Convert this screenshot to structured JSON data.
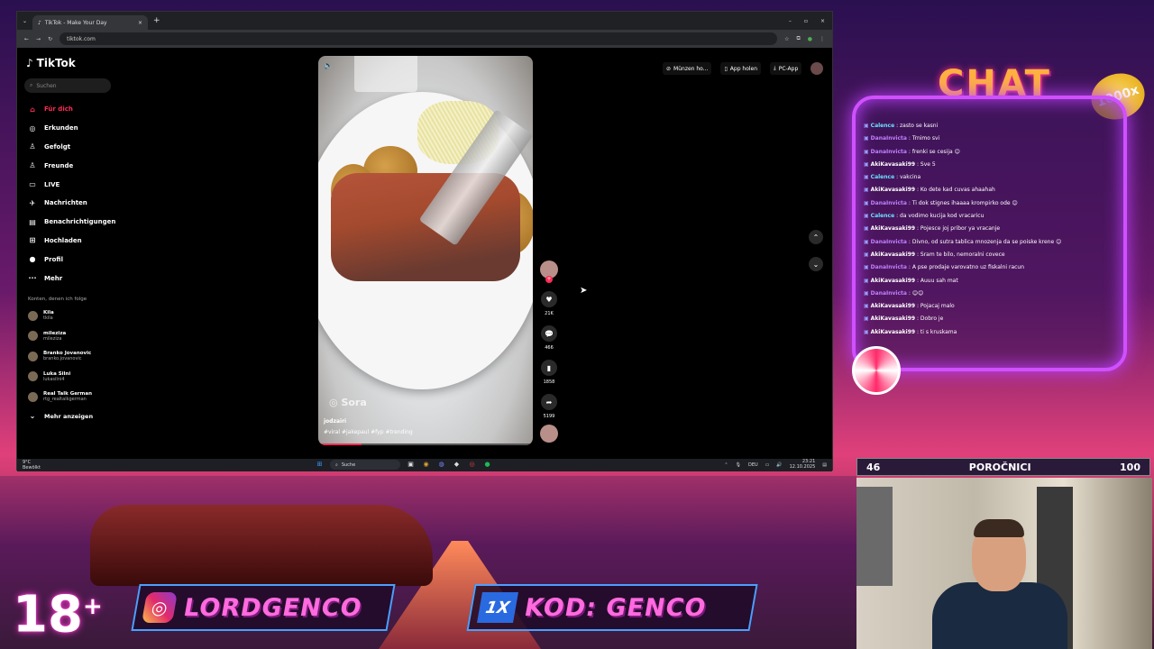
{
  "browser": {
    "tab_title": "TikTok - Make Your Day",
    "url": "tiktok.com"
  },
  "tiktok": {
    "logo": "TikTok",
    "search_placeholder": "Suchen",
    "nav": [
      {
        "label": "Für dich",
        "icon": "home-icon",
        "glyph": "⌂"
      },
      {
        "label": "Erkunden",
        "icon": "compass-icon",
        "glyph": "◎"
      },
      {
        "label": "Gefolgt",
        "icon": "person-follow-icon",
        "glyph": "♙"
      },
      {
        "label": "Freunde",
        "icon": "friends-icon",
        "glyph": "♙"
      },
      {
        "label": "LIVE",
        "icon": "live-icon",
        "glyph": "▭"
      },
      {
        "label": "Nachrichten",
        "icon": "message-icon",
        "glyph": "✈"
      },
      {
        "label": "Benachrichtigungen",
        "icon": "inbox-icon",
        "glyph": "▤"
      },
      {
        "label": "Hochladen",
        "icon": "upload-icon",
        "glyph": "⊞"
      },
      {
        "label": "Profil",
        "icon": "profile-icon",
        "glyph": "●"
      },
      {
        "label": "Mehr",
        "icon": "more-icon",
        "glyph": "···"
      }
    ],
    "following_heading": "Konten, denen ich folge",
    "following": [
      {
        "name": "Kila",
        "handle": "tkila"
      },
      {
        "name": "mileziza",
        "handle": "mileziza"
      },
      {
        "name": "Branko Jovanovic",
        "handle": "branko.jovanovic"
      },
      {
        "name": "Luka Silni",
        "handle": "lukasilni4"
      },
      {
        "name": "Real Talk German",
        "handle": "rtg_realtalkgerman"
      }
    ],
    "show_more": "Mehr anzeigen",
    "topbar": {
      "coins": "Münzen ho...",
      "app": "App holen",
      "pc_app": "PC-App"
    },
    "video": {
      "watermark": "Sora",
      "username": "jodzairi",
      "tags": "#viral #jakepaul #fyp #trending",
      "progress": 0.2
    },
    "actions": {
      "likes": "21K",
      "comments": "466",
      "saves": "1858",
      "shares": "5199"
    }
  },
  "taskbar": {
    "weather_temp": "9°C",
    "weather_desc": "Bewölkt",
    "search": "Suche",
    "lang": "DEU",
    "time": "23:21",
    "date": "12.10.2025"
  },
  "chat": {
    "title": "CHAT",
    "coin": "1000x",
    "messages": [
      {
        "user": "Calence",
        "text": ": zasto se kasni"
      },
      {
        "user": "DanaInvicta",
        "text": ": Trnimo svi"
      },
      {
        "user": "DanaInvicta",
        "text": ": frenki se cesija 😊"
      },
      {
        "user": "AkiKavasaki99",
        "text": ": Sve 5"
      },
      {
        "user": "Calence",
        "text": ": vakcina"
      },
      {
        "user": "AkiKavasaki99",
        "text": ": Ko dete kad cuvas ahaahah"
      },
      {
        "user": "DanaInvicta",
        "text": ": Ti dok stignes ihaaaa krompirko ode 😊"
      },
      {
        "user": "Calence",
        "text": ": da vodimo kucija kod vracaricu"
      },
      {
        "user": "AkiKavasaki99",
        "text": ": Pojesce joj pribor ya vracanje"
      },
      {
        "user": "DanaInvicta",
        "text": ": Divno, od sutra tablica mnozenja da se poiske krene 😊"
      },
      {
        "user": "AkiKavasaki99",
        "text": ": Sram te bilo, nemoralni covece"
      },
      {
        "user": "DanaInvicta",
        "text": ": A pse prodaje varovatno uz fiskalni racun"
      },
      {
        "user": "AkiKavasaki99",
        "text": ": Auuu sah mat"
      },
      {
        "user": "DanaInvicta",
        "text": ": 😊😊"
      },
      {
        "user": "AkiKavasaki99",
        "text": ": Pojacaj malo"
      },
      {
        "user": "AkiKavasaki99",
        "text": ": Dobro je"
      },
      {
        "user": "AkiKavasaki99",
        "text": ": ti s kruskama"
      }
    ]
  },
  "scorebar": {
    "left": "46",
    "center": "POROČNICI",
    "right": "100"
  },
  "overlay": {
    "age": "18",
    "age_sup": "+",
    "instagram": "LORDGENCO",
    "promo_brand": "1X",
    "promo": "KOD: GENCO"
  }
}
